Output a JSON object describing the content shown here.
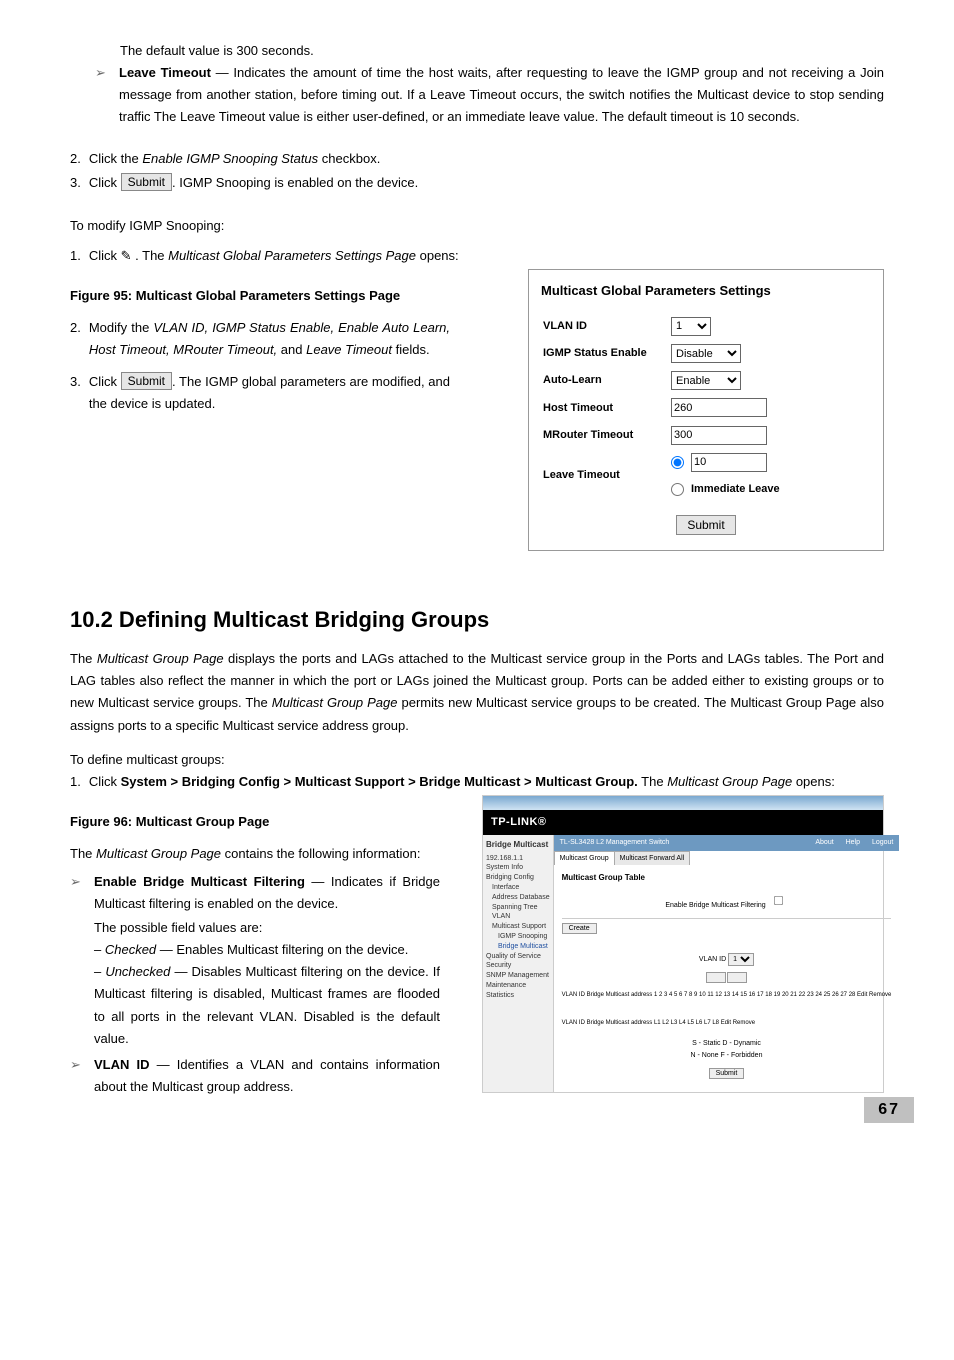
{
  "top": {
    "default_line": "The default value is 300 seconds.",
    "leave_timeout_label": "Leave Timeout",
    "leave_timeout_desc": " — Indicates the amount of time the host waits, after requesting to leave the IGMP group and not receiving a Join message from another station, before timing out. If a Leave Timeout occurs, the switch notifies the Multicast device to stop sending traffic The Leave Timeout value is either user-defined, or an immediate leave value. The default timeout is 10 seconds."
  },
  "steps1": {
    "s2_pre": "Click the ",
    "s2_em": "Enable IGMP Snooping Status",
    "s2_post": " checkbox.",
    "s3_pre": "Click ",
    "s3_btn": "Submit",
    "s3_post": ". IGMP Snooping is enabled on the device."
  },
  "modify_intro": "To modify IGMP Snooping:",
  "modify_s1_pre": "Click ",
  "modify_s1_mid": " . The ",
  "modify_s1_em": "Multicast Global Parameters Settings Page",
  "modify_s1_post": " opens:",
  "fig95_caption": "Figure 95: Multicast Global Parameters Settings Page",
  "fig95": {
    "title": "Multicast Global Parameters Settings",
    "vlan_id_label": "VLAN ID",
    "vlan_id_value": "1",
    "igmp_status_label": "IGMP Status Enable",
    "igmp_status_value": "Disable",
    "auto_learn_label": "Auto-Learn",
    "auto_learn_value": "Enable",
    "host_timeout_label": "Host Timeout",
    "host_timeout_value": "260",
    "mrouter_timeout_label": "MRouter Timeout",
    "mrouter_timeout_value": "300",
    "leave_timeout_label": "Leave Timeout",
    "leave_timeout_value": "10",
    "immediate_leave": "Immediate Leave",
    "submit": "Submit"
  },
  "modify_s2_pre": "Modify the ",
  "modify_s2_em": "VLAN ID, IGMP Status Enable, Enable Auto Learn, Host Timeout, MRouter Timeout,",
  "modify_s2_post": " and ",
  "modify_s2_em2": "Leave Timeout",
  "modify_s2_end": " fields.",
  "modify_s3_pre": "Click ",
  "modify_s3_btn": "Submit",
  "modify_s3_post": ". The IGMP global parameters are modified, and the device is updated.",
  "section_heading": "10.2  Defining Multicast Bridging Groups",
  "section_para_pre": "The ",
  "section_para_em1": "Multicast Group Page",
  "section_para_mid": " displays the ports and LAGs attached to the Multicast service group in the Ports and LAGs tables. The Port and LAG tables also reflect the manner in which the port or LAGs joined the Multicast group. Ports can be added either to existing groups or to new Multicast service groups. The ",
  "section_para_em2": "Multicast Group Page",
  "section_para_post": " permits new Multicast service groups to be created. The Multicast Group Page also assigns ports to a specific Multicast service address group.",
  "define_intro": "To define multicast groups:",
  "define_s1_pre": "Click ",
  "define_s1_bold": "System > Bridging Config > Multicast Support > Bridge Multicast > Multicast Group.",
  "define_s1_mid": " The ",
  "define_s1_em": "Multicast Group Page",
  "define_s1_post": " opens:",
  "fig96_caption": "Figure 96: Multicast Group Page",
  "fig96": {
    "logo": "TP-LINK®",
    "side_title": "Bridge Multicast",
    "side_items": [
      "192.168.1.1",
      "System Info",
      "Bridging Config",
      "Interface",
      "Address Database",
      "Spanning Tree",
      "VLAN",
      "Multicast Support",
      "IGMP Snooping",
      "Bridge Multicast",
      "Quality of Service",
      "Security",
      "SNMP Management",
      "Maintenance",
      "Statistics"
    ],
    "hdr_title": "TL-SL3428 L2 Management Switch",
    "hdr_links": [
      "About",
      "Help",
      "Logout"
    ],
    "tabs": [
      "Multicast Group",
      "Multicast Forward All"
    ],
    "panel_title": "Multicast Group Table",
    "enable_filter": "Enable Bridge Multicast Filtering",
    "create_btn": "Create",
    "vlan_id_lbl": "VLAN ID",
    "vlan_id_val": "1",
    "row1": "VLAN ID Bridge Multicast address  1  2  3  4  5  6  7  8  9 10 11 12 13 14 15 16 17 18 19 20 21 22 23 24 25 26 27 28 Edit Remove",
    "row2": "VLAN ID Bridge Multicast address  L1  L2  L3  L4  L5  L6  L7  L8  Edit Remove",
    "legend1": "S - Static   D - Dynamic",
    "legend2": "N - None   F - Forbidden",
    "submit": "Submit"
  },
  "mgp_intro_pre": "The ",
  "mgp_intro_em": "Multicast Group Page",
  "mgp_intro_post": " contains the following information:",
  "mgp_b1_label": "Enable Bridge Multicast Filtering",
  "mgp_b1_desc": " — Indicates if Bridge Multicast filtering is enabled on the device.",
  "mgp_b1_sub": "The possible field values are:",
  "mgp_b1_d1_em": "Checked",
  "mgp_b1_d1_post": " — Enables Multicast filtering on the device.",
  "mgp_b1_d2_em": "Unchecked",
  "mgp_b1_d2_post": " — Disables Multicast filtering on the device. If Multicast filtering is disabled, Multicast frames are flooded to all ports in the relevant VLAN. Disabled is the default value.",
  "mgp_b2_label": "VLAN ID",
  "mgp_b2_desc": " — Identifies a VLAN and contains information about the Multicast group address.",
  "page_number": "67"
}
